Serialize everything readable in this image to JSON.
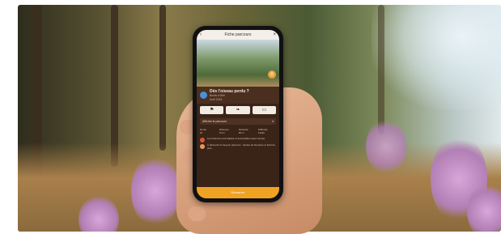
{
  "app": {
    "screen_title": "Fiche parcours",
    "trail_name": "Dés l'oiseau perdu ?",
    "trail_meta_1": "Bords d'Ulhi",
    "trail_meta_2": "Avril 2024",
    "select_label": "Afficher le parcours",
    "stats": [
      {
        "label": "Durée",
        "value": "2h"
      },
      {
        "label": "Distance",
        "value": "6 km"
      },
      {
        "label": "Dénivelé",
        "value": "80 m"
      },
      {
        "label": "Difficulté",
        "value": "Facile"
      }
    ],
    "notes": [
      "Les chemins sont balisés et accessibles toute l'année.",
      "À découvrir le long du parcours : landes de bruyères et forêt de pins."
    ],
    "cta_label": "Démarrer"
  },
  "colors": {
    "accent": "#f0a223",
    "screen_bg": "#3a2418",
    "avatar": "#4a8fd8"
  },
  "icons": {
    "back": "chevron-left-icon",
    "close": "close-icon",
    "hero_badge": "camera-icon",
    "actions": [
      "flag-icon",
      "leaf-icon",
      "camera-icon"
    ]
  }
}
